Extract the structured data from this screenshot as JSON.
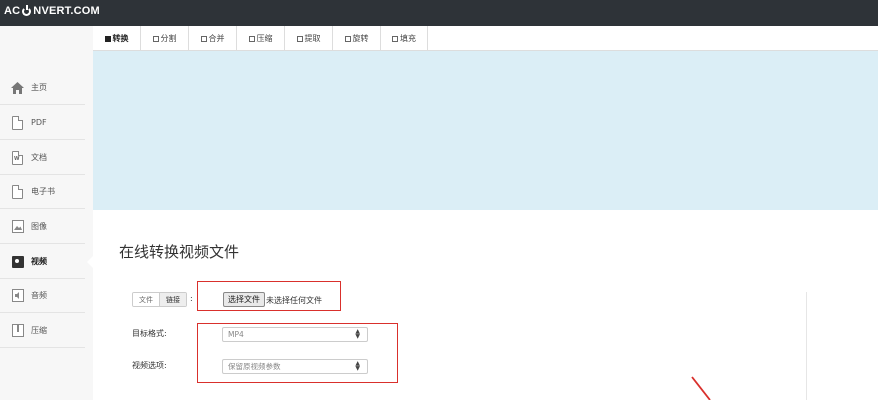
{
  "header": {
    "logo_left": "AC",
    "logo_right": "NVERT.COM"
  },
  "sidebar": {
    "items": [
      {
        "label": "主页",
        "icon": "home-icon"
      },
      {
        "label": "PDF",
        "icon": "pdf-icon"
      },
      {
        "label": "文档",
        "icon": "word-doc-icon",
        "icon_text": "W"
      },
      {
        "label": "电子书",
        "icon": "ebook-icon"
      },
      {
        "label": "图像",
        "icon": "image-icon"
      },
      {
        "label": "视频",
        "icon": "video-icon",
        "active": true
      },
      {
        "label": "音频",
        "icon": "audio-icon"
      },
      {
        "label": "压缩",
        "icon": "archive-icon"
      }
    ]
  },
  "tabs": [
    {
      "label": "转换",
      "active": true
    },
    {
      "label": "分割"
    },
    {
      "label": "合并"
    },
    {
      "label": "压缩"
    },
    {
      "label": "提取"
    },
    {
      "label": "旋转"
    },
    {
      "label": "填充"
    }
  ],
  "main": {
    "title": "在线转换视频文件",
    "source_toggle": {
      "file_label": "文件",
      "link_label": "链接"
    },
    "source_colon": ":",
    "file_button": "选择文件",
    "file_status": "未选择任何文件",
    "target_format": {
      "label": "目标格式:",
      "value": "MP4"
    },
    "video_options": {
      "label": "视频选项:",
      "value": "保留原视频参数"
    }
  },
  "colors": {
    "topbar": "#2e3338",
    "banner": "#dbeef6",
    "highlight": "#d9302c"
  }
}
